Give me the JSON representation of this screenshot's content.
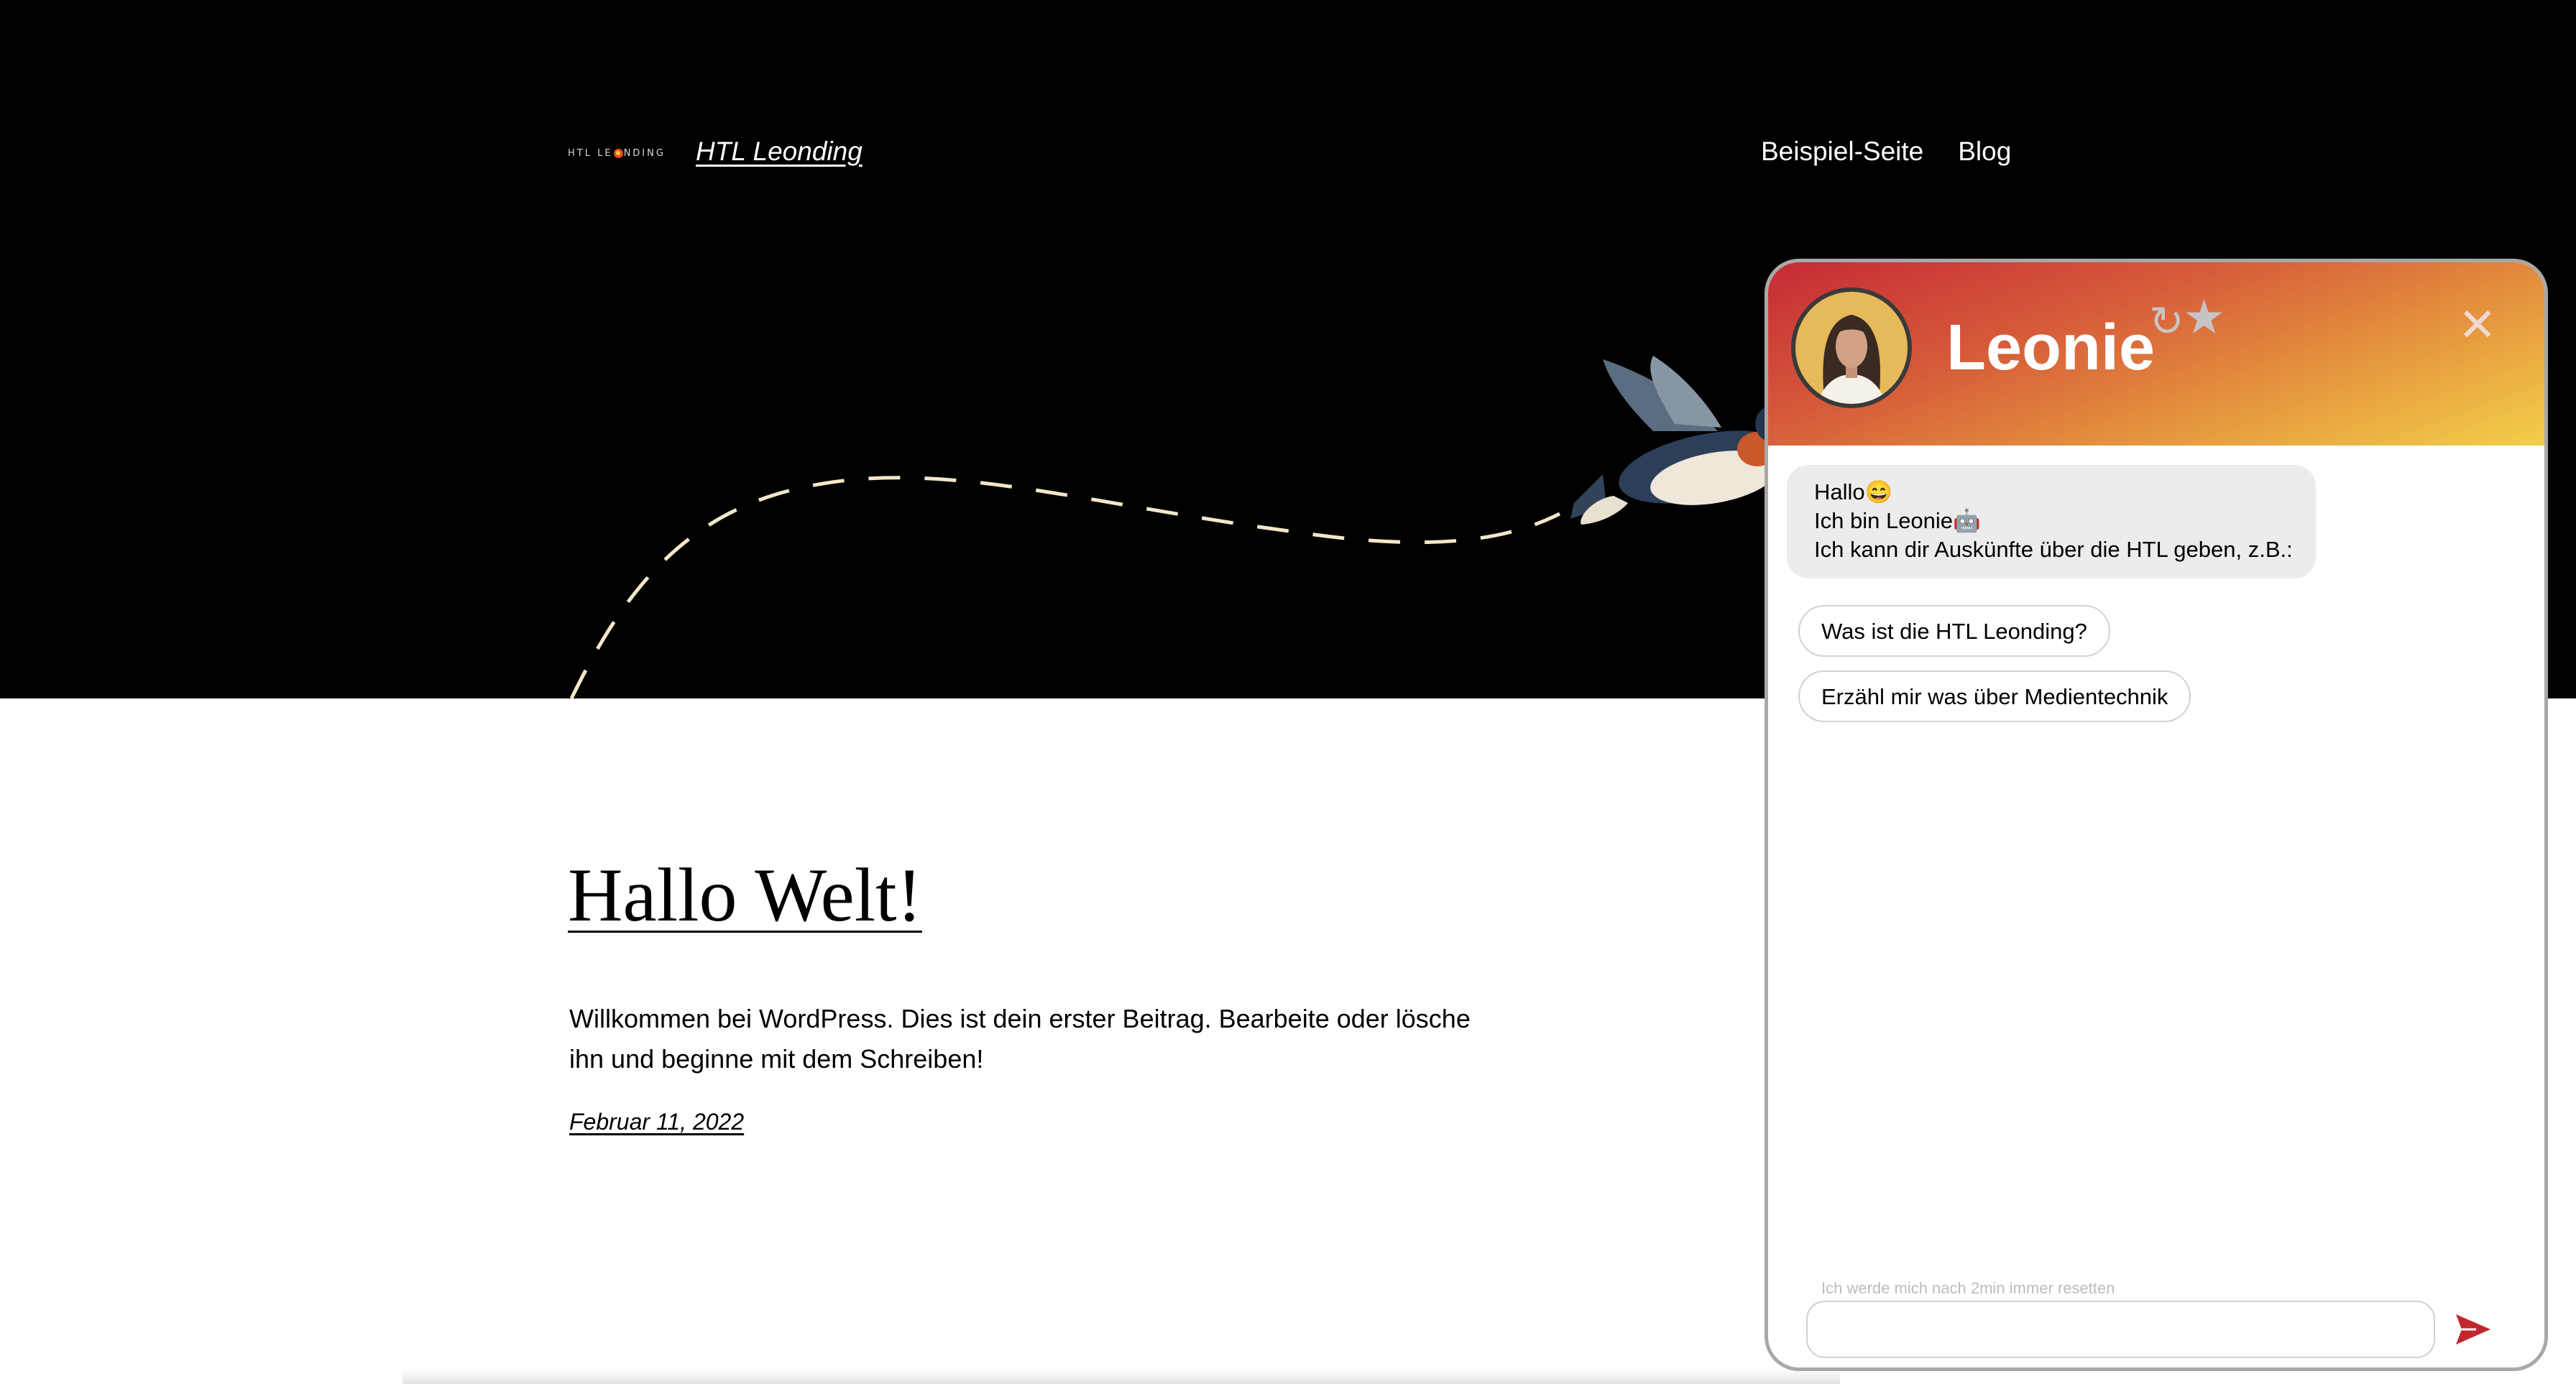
{
  "header": {
    "logo_text": "HTL LEONDING",
    "site_title": "HTL Leonding",
    "nav": [
      {
        "label": "Beispiel-Seite"
      },
      {
        "label": "Blog"
      }
    ]
  },
  "post": {
    "title": "Hallo Welt!",
    "body": "Willkommen bei WordPress. Dies ist dein erster Beitrag. Bearbeite oder lösche ihn und beginne mit dem Schreiben!",
    "date": "Februar 11, 2022"
  },
  "chat": {
    "bot_name": "Leonie",
    "reset_symbol": "↻",
    "star_symbol": "★",
    "close_symbol": "✕",
    "messages": [
      {
        "lines": [
          "Hallo😄",
          "Ich bin Leonie🤖",
          "Ich kann dir Auskünfte über die HTL geben, z.B.:"
        ]
      }
    ],
    "suggestions": [
      {
        "label": "Was ist die HTL Leonding?"
      },
      {
        "label": "Erzähl mir was über Medientechnik"
      }
    ],
    "reset_hint": "Ich werde mich nach 2min immer resetten",
    "input_value": "",
    "input_placeholder": ""
  },
  "colors": {
    "header_bg": "#000000",
    "accent_red": "#c1272d",
    "chat_gradient_start": "#c62a36",
    "chat_gradient_end": "#f3cf4a"
  },
  "icons": [
    "htl-logo-icon",
    "bird-illustration",
    "avatar-icon",
    "reset-icon",
    "star-icon",
    "close-icon",
    "send-icon"
  ]
}
